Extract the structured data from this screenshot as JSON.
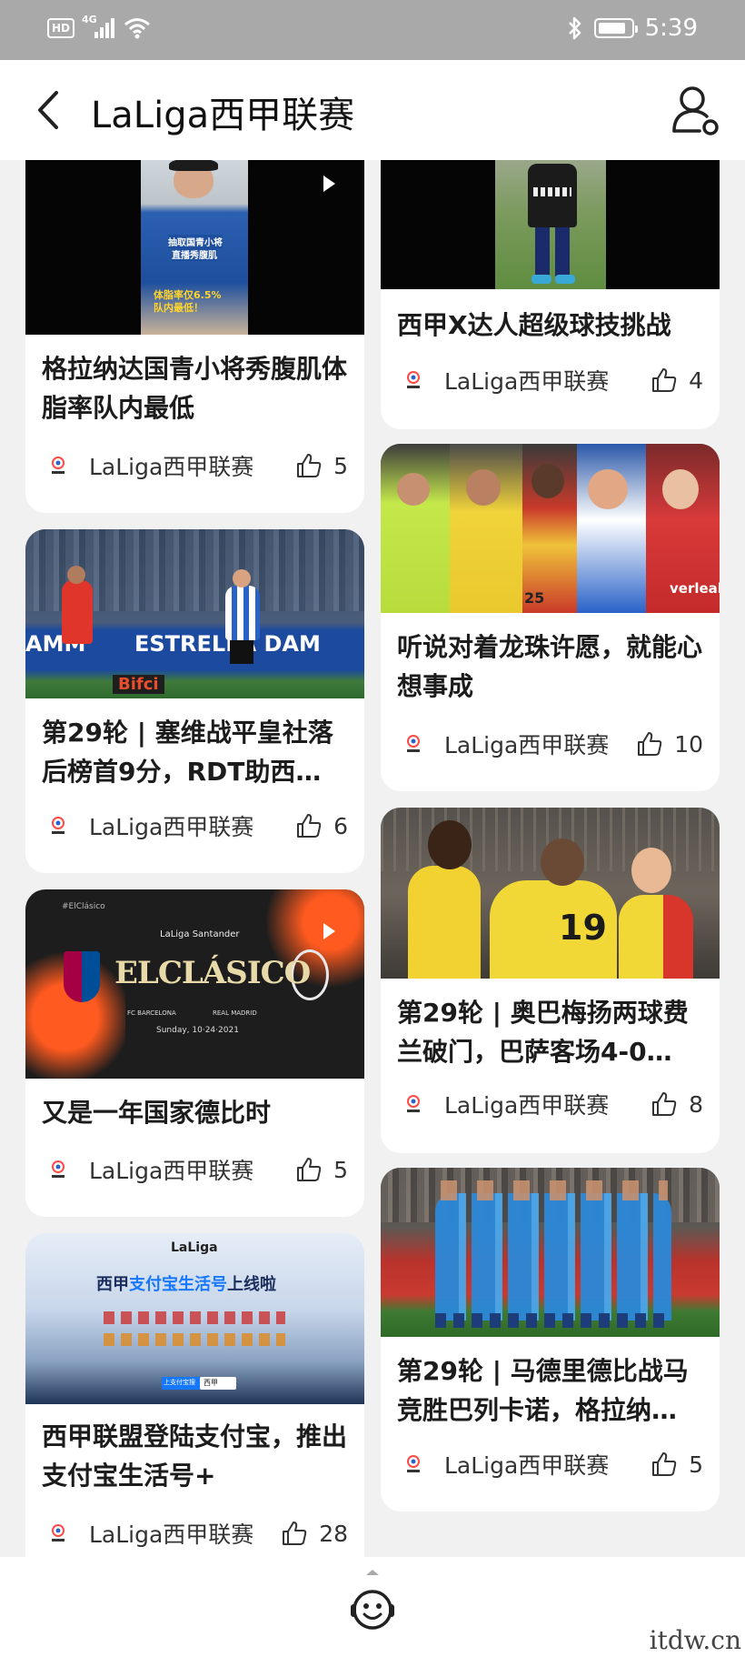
{
  "status_bar": {
    "hd": "HD",
    "network": "4G",
    "time": "5:39",
    "battery_level": 0.85
  },
  "header": {
    "title": "LaLiga西甲联赛",
    "back_icon": "chevron-left-icon",
    "profile_icon": "user-settings-icon"
  },
  "left_column": [
    {
      "title": "格拉纳达国青小将秀腹肌体脂率队内最低",
      "source": "LaLiga西甲联赛",
      "likes": "5",
      "has_play": true,
      "overlay": [
        "抽取国青小将",
        "直播秀腹肌",
        "体脂率仅6.5%",
        "队内最低！"
      ]
    },
    {
      "title": "第29轮 | 塞维战平皇社落后榜首9分，RDT助西…",
      "source": "LaLiga西甲联赛",
      "likes": "6",
      "overlay": [
        "ESTRELLA DAM",
        "Bifci"
      ]
    },
    {
      "title": "又是一年国家德比时",
      "source": "LaLiga西甲联赛",
      "likes": "5",
      "has_play": true,
      "overlay": [
        "#ElClásico",
        "LaLiga Santander",
        "ELCLÁSICO",
        "FC BARCELONA",
        "REAL MADRID",
        "Sunday, 10·24·2021"
      ]
    },
    {
      "title": "西甲联盟登陆支付宝，推出支付宝生活号+",
      "source": "LaLiga西甲联赛",
      "likes": "28",
      "overlay": [
        "LaLiga",
        "西甲",
        "支付宝生活号",
        "上线啦",
        "上支付宝搜",
        "西甲"
      ]
    }
  ],
  "right_column": [
    {
      "title": "西甲X达人超级球技挑战",
      "source": "LaLiga西甲联赛",
      "likes": "4"
    },
    {
      "title": "听说对着龙珠许愿，就能心想事成",
      "source": "LaLiga西甲联赛",
      "likes": "10",
      "overlay": [
        "verleal",
        "25"
      ]
    },
    {
      "title": "第29轮 | 奥巴梅扬两球费兰破门，巴萨客场4-0…",
      "source": "LaLiga西甲联赛",
      "likes": "8",
      "overlay": [
        "19"
      ]
    },
    {
      "title": "第29轮 | 马德里德比战马竞胜巴列卡诺，格拉纳…",
      "source": "LaLiga西甲联赛",
      "likes": "5"
    }
  ],
  "bottom_bar": {
    "assistant_icon": "assistant-robot-icon",
    "expand_icon": "chevron-up-icon"
  },
  "watermark": "itdw.cn",
  "colors": {
    "status_bar": "#a9a9a9",
    "background": "#f1f1f1",
    "card": "#ffffff"
  }
}
